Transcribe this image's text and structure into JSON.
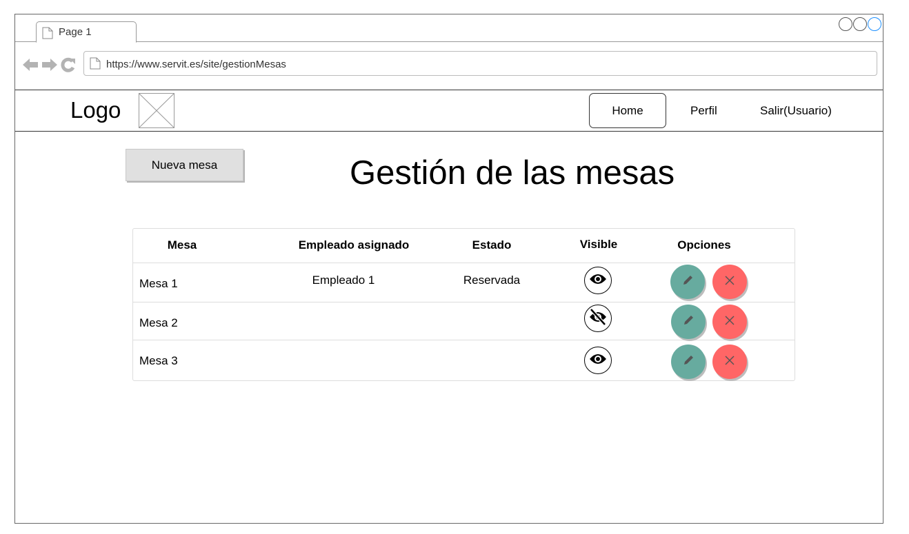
{
  "browser": {
    "tab_label": "Page 1",
    "url": "https://www.servit.es/site/gestionMesas"
  },
  "navbar": {
    "logo_text": "Logo",
    "home_label": "Home",
    "perfil_label": "Perfil",
    "salir_label": "Salir(Usuario)"
  },
  "main": {
    "new_button_label": "Nueva mesa",
    "title": "Gestión de las mesas"
  },
  "table": {
    "headers": {
      "mesa": "Mesa",
      "empleado": "Empleado asignado",
      "estado": "Estado",
      "visible": "Visible",
      "opciones": "Opciones"
    },
    "rows": [
      {
        "mesa": "Mesa 1",
        "empleado": "Empleado 1",
        "estado": "Reservada",
        "visible": true
      },
      {
        "mesa": "Mesa 2",
        "empleado": "",
        "estado": "",
        "visible": false
      },
      {
        "mesa": "Mesa 3",
        "empleado": "",
        "estado": "",
        "visible": true
      }
    ]
  },
  "icons": {
    "visible": "eye-icon",
    "hidden": "eye-off-icon",
    "edit": "pencil-icon",
    "delete": "close-icon"
  },
  "colors": {
    "edit_button": "#67ab9f",
    "delete_button": "#ff6666",
    "new_button": "#e0e0e0"
  }
}
